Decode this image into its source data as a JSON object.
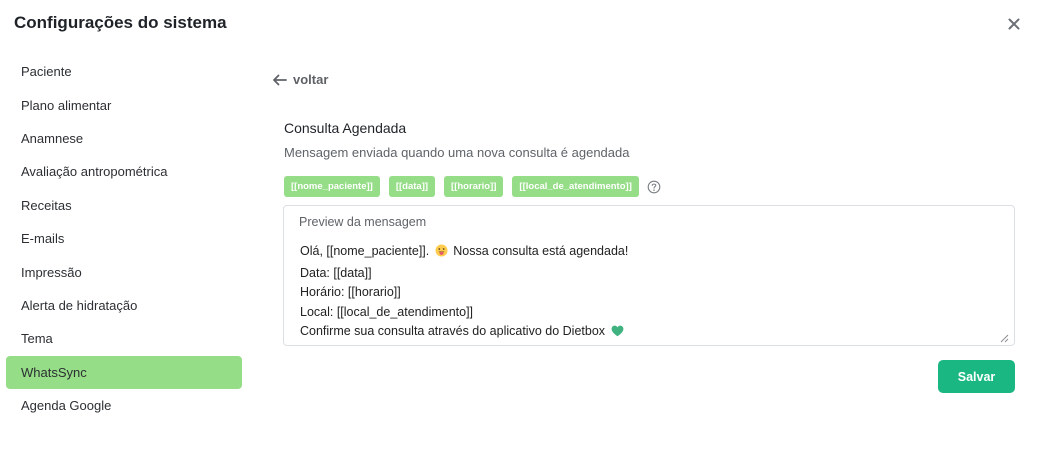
{
  "modal": {
    "title": "Configurações do sistema",
    "close_icon": "close-icon"
  },
  "sidebar": {
    "items": [
      {
        "label": "Paciente"
      },
      {
        "label": "Plano alimentar"
      },
      {
        "label": "Anamnese"
      },
      {
        "label": "Avaliação antropométrica"
      },
      {
        "label": "Receitas"
      },
      {
        "label": "E-mails"
      },
      {
        "label": "Impressão"
      },
      {
        "label": "Alerta de hidratação"
      },
      {
        "label": "Tema"
      },
      {
        "label": "WhatsSync",
        "active": true
      },
      {
        "label": "Agenda Google"
      }
    ],
    "active_color": "#95dd87"
  },
  "content": {
    "back_label": "voltar",
    "section_title": "Consulta Agendada",
    "section_description": "Mensagem enviada quando uma nova consulta é agendada",
    "variables": [
      "[[nome_paciente]]",
      "[[data]]",
      "[[horario]]",
      "[[local_de_atendimento]]"
    ],
    "help_icon": "question-circle-icon",
    "preview": {
      "label": "Preview da mensagem",
      "lines": {
        "greeting_prefix": "Olá, [[nome_paciente]].",
        "greeting_suffix": "Nossa consulta está agendada!",
        "date": "Data: [[data]]",
        "time": "Horário: [[horario]]",
        "location": "Local: [[local_de_atendimento]]",
        "confirm": "Confirme sua consulta através do aplicativo do Dietbox"
      },
      "emoji_icons": [
        "smiling-face-tongue-emoji",
        "green-heart-emoji"
      ]
    },
    "save_label": "Salvar",
    "save_color": "#1ab783"
  }
}
